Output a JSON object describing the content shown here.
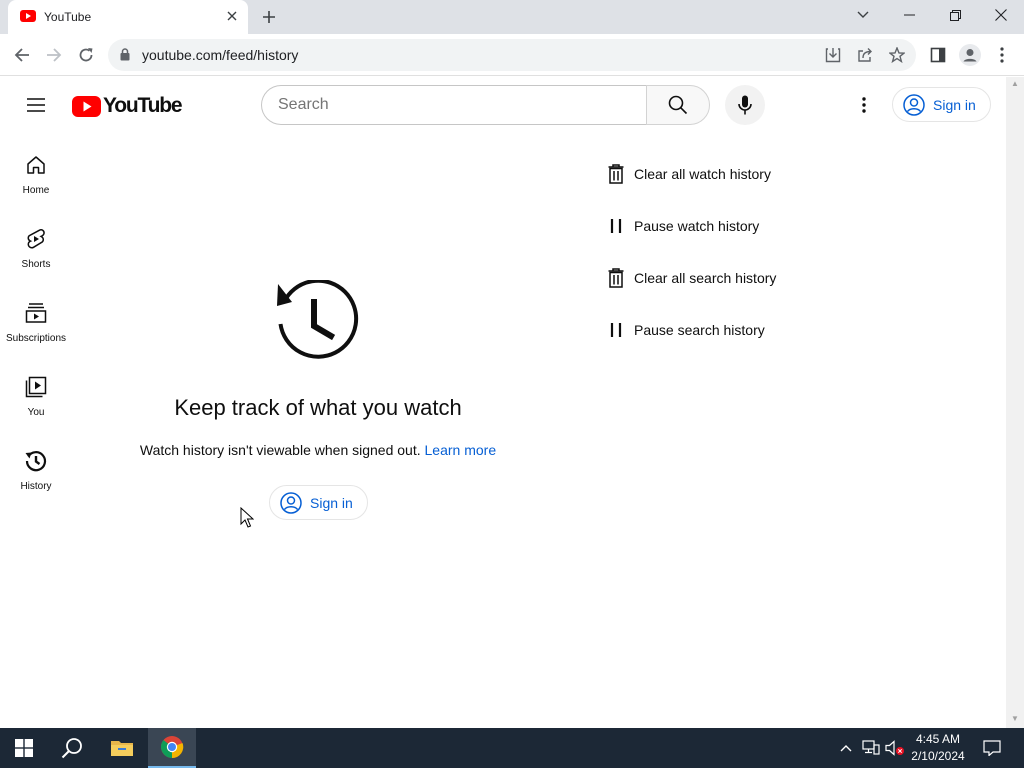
{
  "browser": {
    "tab_title": "YouTube",
    "url": "youtube.com/feed/history"
  },
  "masthead": {
    "logo_text": "YouTube",
    "search_placeholder": "Search",
    "signin_label": "Sign in"
  },
  "guide": {
    "items": [
      {
        "label": "Home",
        "icon": "home-icon"
      },
      {
        "label": "Shorts",
        "icon": "shorts-icon"
      },
      {
        "label": "Subscriptions",
        "icon": "subscriptions-icon"
      },
      {
        "label": "You",
        "icon": "you-icon"
      },
      {
        "label": "History",
        "icon": "history-icon"
      }
    ]
  },
  "main": {
    "title": "Keep track of what you watch",
    "subtitle": "Watch history isn't viewable when signed out.",
    "learn_more": "Learn more",
    "signin_label": "Sign in"
  },
  "actions": [
    {
      "label": "Clear all watch history",
      "icon": "trash-icon"
    },
    {
      "label": "Pause watch history",
      "icon": "pause-icon"
    },
    {
      "label": "Clear all search history",
      "icon": "trash-icon"
    },
    {
      "label": "Pause search history",
      "icon": "pause-icon"
    }
  ],
  "taskbar": {
    "time": "4:45 AM",
    "date": "2/10/2024"
  },
  "colors": {
    "youtube_red": "#ff0000",
    "link_blue": "#065fd4",
    "taskbar_bg": "#1c2836"
  }
}
